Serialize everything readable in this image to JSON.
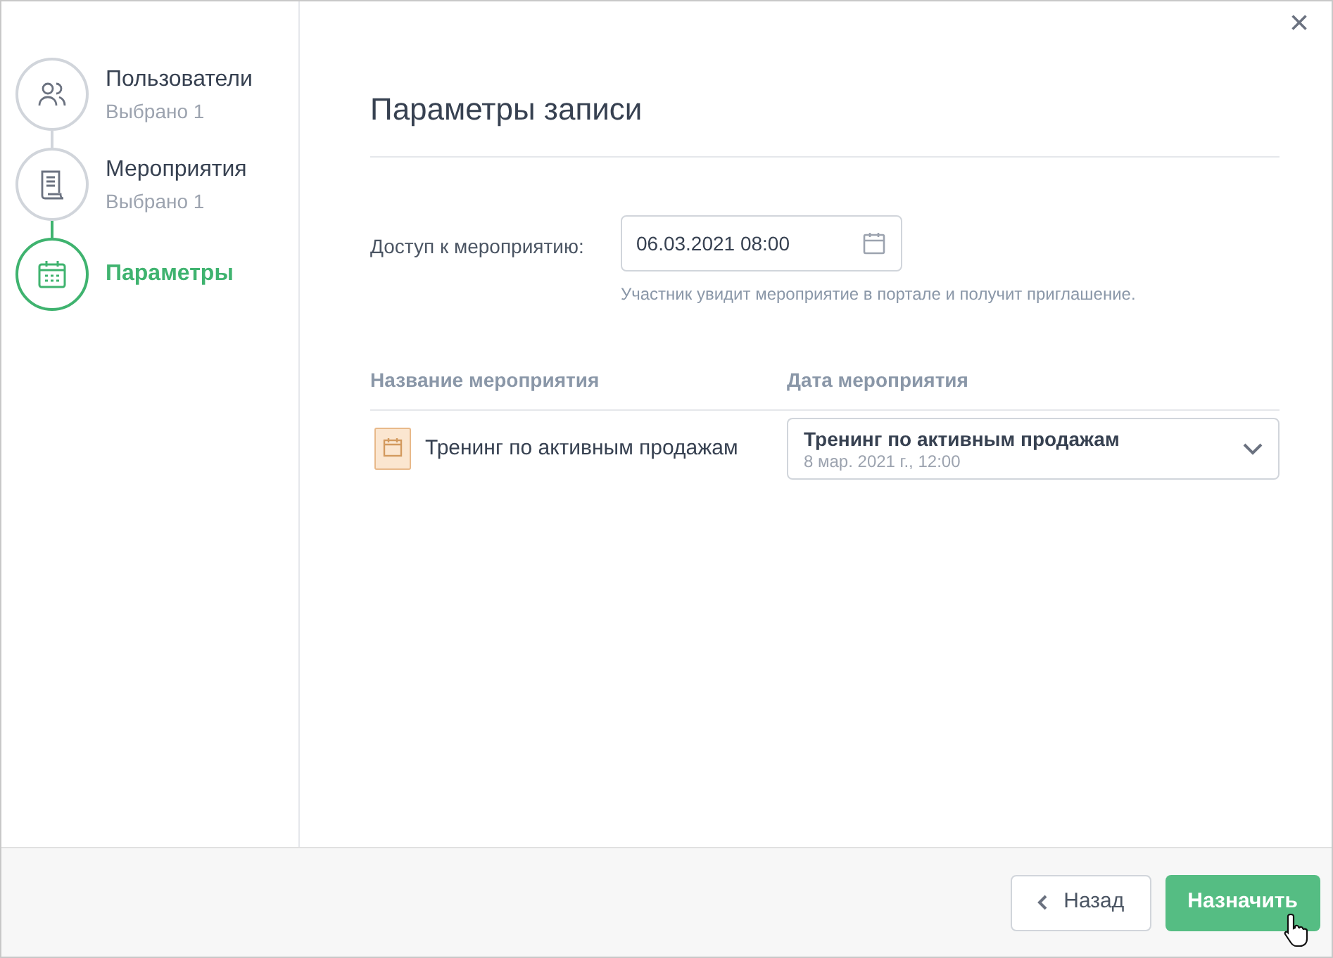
{
  "steps": [
    {
      "kind": "users",
      "title": "Пользователи",
      "subtitle": "Выбрано 1",
      "selected": false
    },
    {
      "kind": "events",
      "title": "Мероприятия",
      "subtitle": "Выбрано 1",
      "selected": false
    },
    {
      "kind": "calendar",
      "title": "Параметры",
      "selected": true
    }
  ],
  "close": "×",
  "heading": "Параметры записи",
  "access": {
    "label": "Доступ к мероприятию:",
    "value": "06.03.2021 08:00",
    "hint": "Участник увидит мероприятие в портале и получит приглашение."
  },
  "table": {
    "columns": [
      "Название мероприятия",
      "Дата мероприятия"
    ],
    "rows": [
      {
        "name": "Тренинг по активным продажам",
        "date_title": "Тренинг по активным продажам",
        "date_sub": "8 мар. 2021 г., 12:00"
      }
    ]
  },
  "buttons": [
    {
      "kind": "back",
      "label": "Назад"
    },
    {
      "kind": "primary",
      "label": "Назначить"
    }
  ]
}
